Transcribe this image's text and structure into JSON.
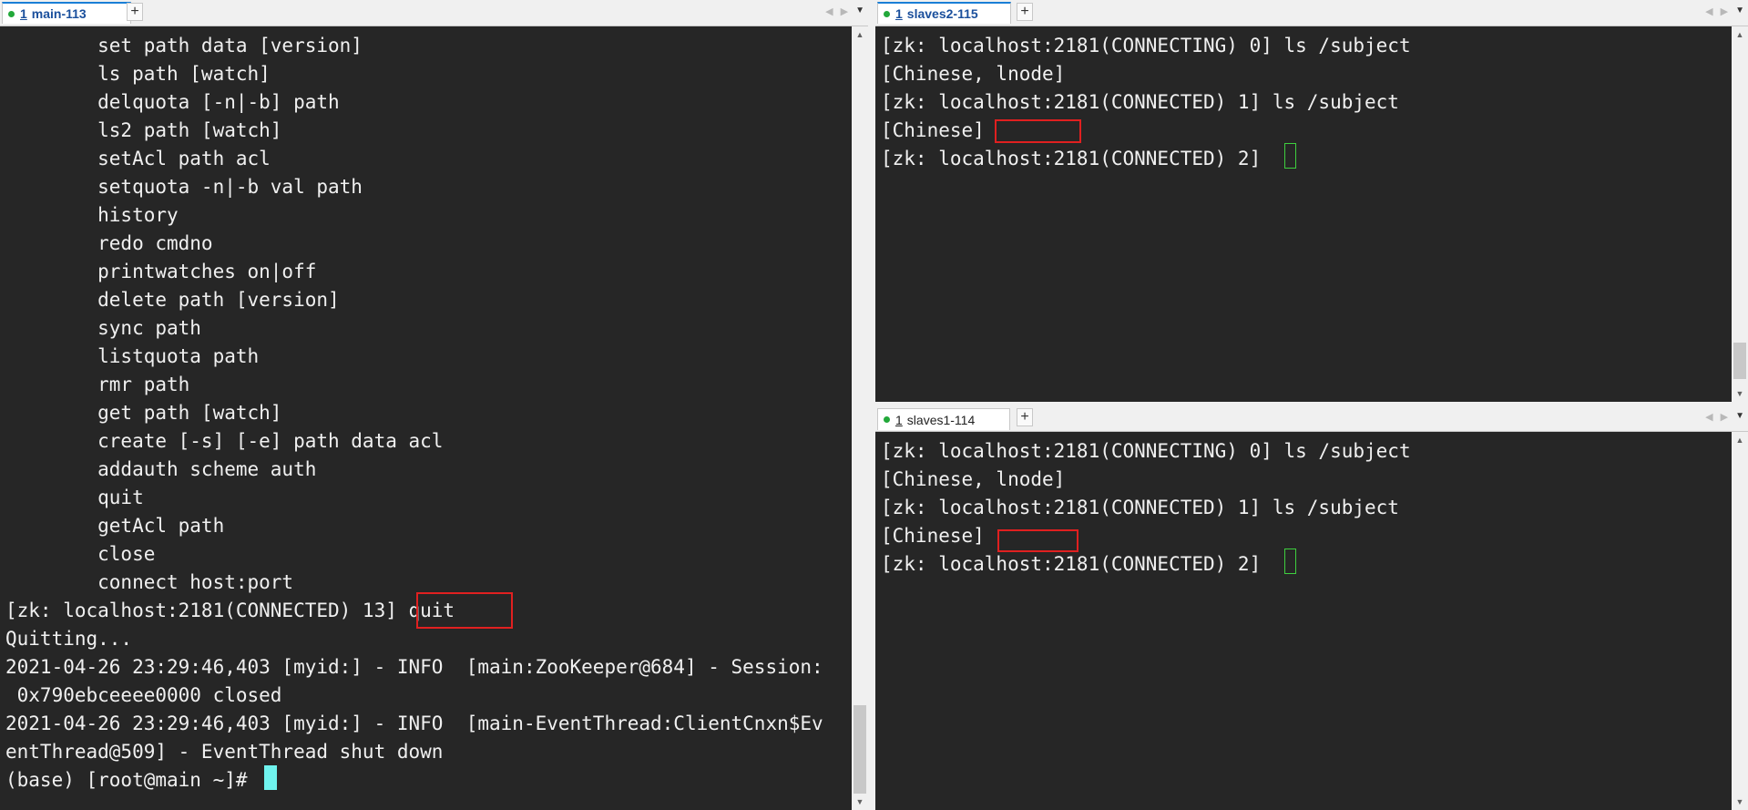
{
  "left_pane": {
    "tab_number": "1",
    "tab_label": "main-113",
    "lines": [
      "        set path data [version]",
      "        ls path [watch]",
      "        delquota [-n|-b] path",
      "        ls2 path [watch]",
      "        setAcl path acl",
      "        setquota -n|-b val path",
      "        history",
      "        redo cmdno",
      "        printwatches on|off",
      "        delete path [version]",
      "        sync path",
      "        listquota path",
      "        rmr path",
      "        get path [watch]",
      "        create [-s] [-e] path data acl",
      "        addauth scheme auth",
      "        quit",
      "        getAcl path",
      "        close",
      "        connect host:port",
      "[zk: localhost:2181(CONNECTED) 13] quit",
      "Quitting...",
      "2021-04-26 23:29:46,403 [myid:] - INFO  [main:ZooKeeper@684] - Session:",
      " 0x790ebceeee0000 closed",
      "2021-04-26 23:29:46,403 [myid:] - INFO  [main-EventThread:ClientCnxn$Ev",
      "entThread@509] - EventThread shut down",
      "(base) [root@main ~]# "
    ]
  },
  "top_right_pane": {
    "tab_number": "1",
    "tab_label": "slaves2-115",
    "lines": [
      "[zk: localhost:2181(CONNECTING) 0] ls /subject",
      "[Chinese, lnode]",
      "[zk: localhost:2181(CONNECTED) 1] ls /subject",
      "[Chinese]",
      "[zk: localhost:2181(CONNECTED) 2] "
    ]
  },
  "bottom_right_pane": {
    "tab_number": "1",
    "tab_label": "slaves1-114",
    "lines": [
      "[zk: localhost:2181(CONNECTING) 0] ls /subject",
      "[Chinese, lnode]",
      "[zk: localhost:2181(CONNECTED) 1] ls /subject",
      "[Chinese]",
      "[zk: localhost:2181(CONNECTED) 2] "
    ]
  },
  "ui": {
    "add_tab": "+",
    "nav_prev": "◀",
    "nav_next": "▶",
    "nav_menu": "▼",
    "scroll_up": "▲",
    "scroll_down": "▼"
  },
  "colors": {
    "terminal_bg": "#262626",
    "terminal_fg": "#f0f0f0",
    "highlight_box": "#e02020",
    "cursor": "#6ff3ee",
    "session_dot": "#22a83a"
  }
}
